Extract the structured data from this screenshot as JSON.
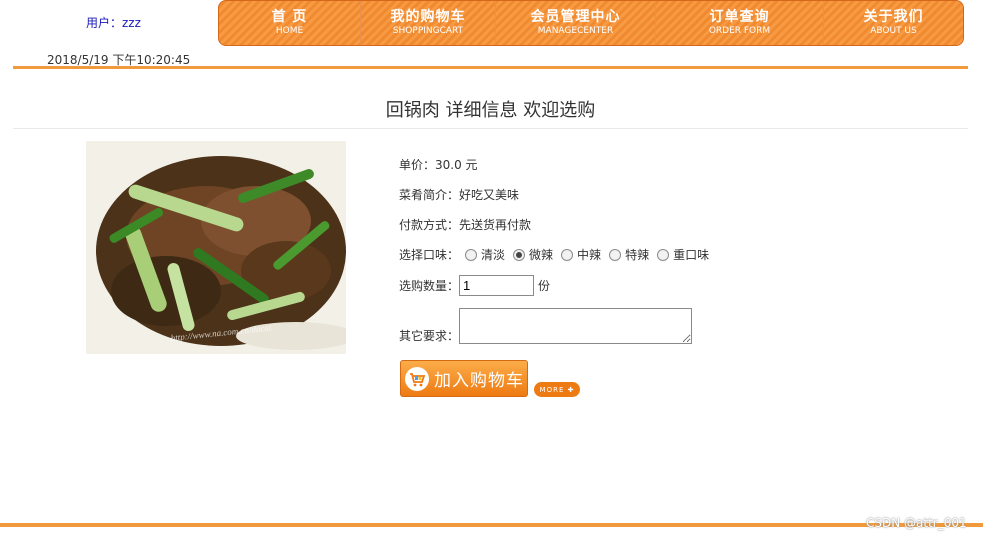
{
  "header": {
    "user": "用户：zzz",
    "datetime": "2018/5/19 下午10:20:45"
  },
  "nav": {
    "items": [
      {
        "cn": "首  页",
        "en": "HOME"
      },
      {
        "cn": "我的购物车",
        "en": "SHOPPINGCART"
      },
      {
        "cn": "会员管理中心",
        "en": "MANAGECENTER"
      },
      {
        "cn": "订单查询",
        "en": "ORDER FORM"
      },
      {
        "cn": "关于我们",
        "en": "ABOUT US"
      }
    ]
  },
  "product": {
    "title": "回锅肉 详细信息 欢迎选购",
    "price_label": "单价：30.0 元",
    "desc_label": "菜肴简介：好吃又美味",
    "pay_label": "付款方式：先送货再付款",
    "taste_label": "选择口味：",
    "taste_options": [
      "清淡",
      "微辣",
      "中辣",
      "特辣",
      "重口味"
    ],
    "taste_selected": "微辣",
    "qty_label": "选购数量：",
    "qty_value": "1",
    "qty_unit": "份",
    "req_label": "其它要求：",
    "req_value": "",
    "photo_watermark": "http://www.na.com.cn/dacai"
  },
  "actions": {
    "add_to_cart": "加入购物车",
    "more": "MORE ✚"
  },
  "footer": {
    "watermark": "CSDN @attr_001"
  },
  "colors": {
    "accent": "#f19a3c",
    "nav_bg": "#f08a30",
    "user_link": "#1a1ab8"
  }
}
